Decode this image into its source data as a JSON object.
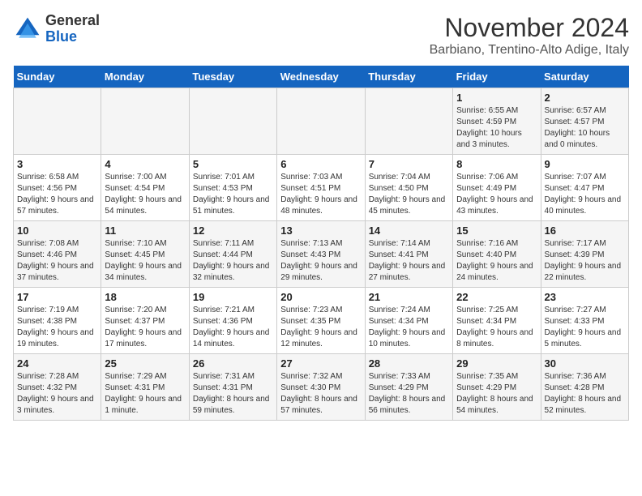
{
  "header": {
    "logo_general": "General",
    "logo_blue": "Blue",
    "calendar_title": "November 2024",
    "calendar_subtitle": "Barbiano, Trentino-Alto Adige, Italy"
  },
  "weekdays": [
    "Sunday",
    "Monday",
    "Tuesday",
    "Wednesday",
    "Thursday",
    "Friday",
    "Saturday"
  ],
  "weeks": [
    [
      {
        "day": "",
        "sunrise": "",
        "sunset": "",
        "daylight": ""
      },
      {
        "day": "",
        "sunrise": "",
        "sunset": "",
        "daylight": ""
      },
      {
        "day": "",
        "sunrise": "",
        "sunset": "",
        "daylight": ""
      },
      {
        "day": "",
        "sunrise": "",
        "sunset": "",
        "daylight": ""
      },
      {
        "day": "",
        "sunrise": "",
        "sunset": "",
        "daylight": ""
      },
      {
        "day": "1",
        "sunrise": "Sunrise: 6:55 AM",
        "sunset": "Sunset: 4:59 PM",
        "daylight": "Daylight: 10 hours and 3 minutes."
      },
      {
        "day": "2",
        "sunrise": "Sunrise: 6:57 AM",
        "sunset": "Sunset: 4:57 PM",
        "daylight": "Daylight: 10 hours and 0 minutes."
      }
    ],
    [
      {
        "day": "3",
        "sunrise": "Sunrise: 6:58 AM",
        "sunset": "Sunset: 4:56 PM",
        "daylight": "Daylight: 9 hours and 57 minutes."
      },
      {
        "day": "4",
        "sunrise": "Sunrise: 7:00 AM",
        "sunset": "Sunset: 4:54 PM",
        "daylight": "Daylight: 9 hours and 54 minutes."
      },
      {
        "day": "5",
        "sunrise": "Sunrise: 7:01 AM",
        "sunset": "Sunset: 4:53 PM",
        "daylight": "Daylight: 9 hours and 51 minutes."
      },
      {
        "day": "6",
        "sunrise": "Sunrise: 7:03 AM",
        "sunset": "Sunset: 4:51 PM",
        "daylight": "Daylight: 9 hours and 48 minutes."
      },
      {
        "day": "7",
        "sunrise": "Sunrise: 7:04 AM",
        "sunset": "Sunset: 4:50 PM",
        "daylight": "Daylight: 9 hours and 45 minutes."
      },
      {
        "day": "8",
        "sunrise": "Sunrise: 7:06 AM",
        "sunset": "Sunset: 4:49 PM",
        "daylight": "Daylight: 9 hours and 43 minutes."
      },
      {
        "day": "9",
        "sunrise": "Sunrise: 7:07 AM",
        "sunset": "Sunset: 4:47 PM",
        "daylight": "Daylight: 9 hours and 40 minutes."
      }
    ],
    [
      {
        "day": "10",
        "sunrise": "Sunrise: 7:08 AM",
        "sunset": "Sunset: 4:46 PM",
        "daylight": "Daylight: 9 hours and 37 minutes."
      },
      {
        "day": "11",
        "sunrise": "Sunrise: 7:10 AM",
        "sunset": "Sunset: 4:45 PM",
        "daylight": "Daylight: 9 hours and 34 minutes."
      },
      {
        "day": "12",
        "sunrise": "Sunrise: 7:11 AM",
        "sunset": "Sunset: 4:44 PM",
        "daylight": "Daylight: 9 hours and 32 minutes."
      },
      {
        "day": "13",
        "sunrise": "Sunrise: 7:13 AM",
        "sunset": "Sunset: 4:43 PM",
        "daylight": "Daylight: 9 hours and 29 minutes."
      },
      {
        "day": "14",
        "sunrise": "Sunrise: 7:14 AM",
        "sunset": "Sunset: 4:41 PM",
        "daylight": "Daylight: 9 hours and 27 minutes."
      },
      {
        "day": "15",
        "sunrise": "Sunrise: 7:16 AM",
        "sunset": "Sunset: 4:40 PM",
        "daylight": "Daylight: 9 hours and 24 minutes."
      },
      {
        "day": "16",
        "sunrise": "Sunrise: 7:17 AM",
        "sunset": "Sunset: 4:39 PM",
        "daylight": "Daylight: 9 hours and 22 minutes."
      }
    ],
    [
      {
        "day": "17",
        "sunrise": "Sunrise: 7:19 AM",
        "sunset": "Sunset: 4:38 PM",
        "daylight": "Daylight: 9 hours and 19 minutes."
      },
      {
        "day": "18",
        "sunrise": "Sunrise: 7:20 AM",
        "sunset": "Sunset: 4:37 PM",
        "daylight": "Daylight: 9 hours and 17 minutes."
      },
      {
        "day": "19",
        "sunrise": "Sunrise: 7:21 AM",
        "sunset": "Sunset: 4:36 PM",
        "daylight": "Daylight: 9 hours and 14 minutes."
      },
      {
        "day": "20",
        "sunrise": "Sunrise: 7:23 AM",
        "sunset": "Sunset: 4:35 PM",
        "daylight": "Daylight: 9 hours and 12 minutes."
      },
      {
        "day": "21",
        "sunrise": "Sunrise: 7:24 AM",
        "sunset": "Sunset: 4:34 PM",
        "daylight": "Daylight: 9 hours and 10 minutes."
      },
      {
        "day": "22",
        "sunrise": "Sunrise: 7:25 AM",
        "sunset": "Sunset: 4:34 PM",
        "daylight": "Daylight: 9 hours and 8 minutes."
      },
      {
        "day": "23",
        "sunrise": "Sunrise: 7:27 AM",
        "sunset": "Sunset: 4:33 PM",
        "daylight": "Daylight: 9 hours and 5 minutes."
      }
    ],
    [
      {
        "day": "24",
        "sunrise": "Sunrise: 7:28 AM",
        "sunset": "Sunset: 4:32 PM",
        "daylight": "Daylight: 9 hours and 3 minutes."
      },
      {
        "day": "25",
        "sunrise": "Sunrise: 7:29 AM",
        "sunset": "Sunset: 4:31 PM",
        "daylight": "Daylight: 9 hours and 1 minute."
      },
      {
        "day": "26",
        "sunrise": "Sunrise: 7:31 AM",
        "sunset": "Sunset: 4:31 PM",
        "daylight": "Daylight: 8 hours and 59 minutes."
      },
      {
        "day": "27",
        "sunrise": "Sunrise: 7:32 AM",
        "sunset": "Sunset: 4:30 PM",
        "daylight": "Daylight: 8 hours and 57 minutes."
      },
      {
        "day": "28",
        "sunrise": "Sunrise: 7:33 AM",
        "sunset": "Sunset: 4:29 PM",
        "daylight": "Daylight: 8 hours and 56 minutes."
      },
      {
        "day": "29",
        "sunrise": "Sunrise: 7:35 AM",
        "sunset": "Sunset: 4:29 PM",
        "daylight": "Daylight: 8 hours and 54 minutes."
      },
      {
        "day": "30",
        "sunrise": "Sunrise: 7:36 AM",
        "sunset": "Sunset: 4:28 PM",
        "daylight": "Daylight: 8 hours and 52 minutes."
      }
    ]
  ]
}
